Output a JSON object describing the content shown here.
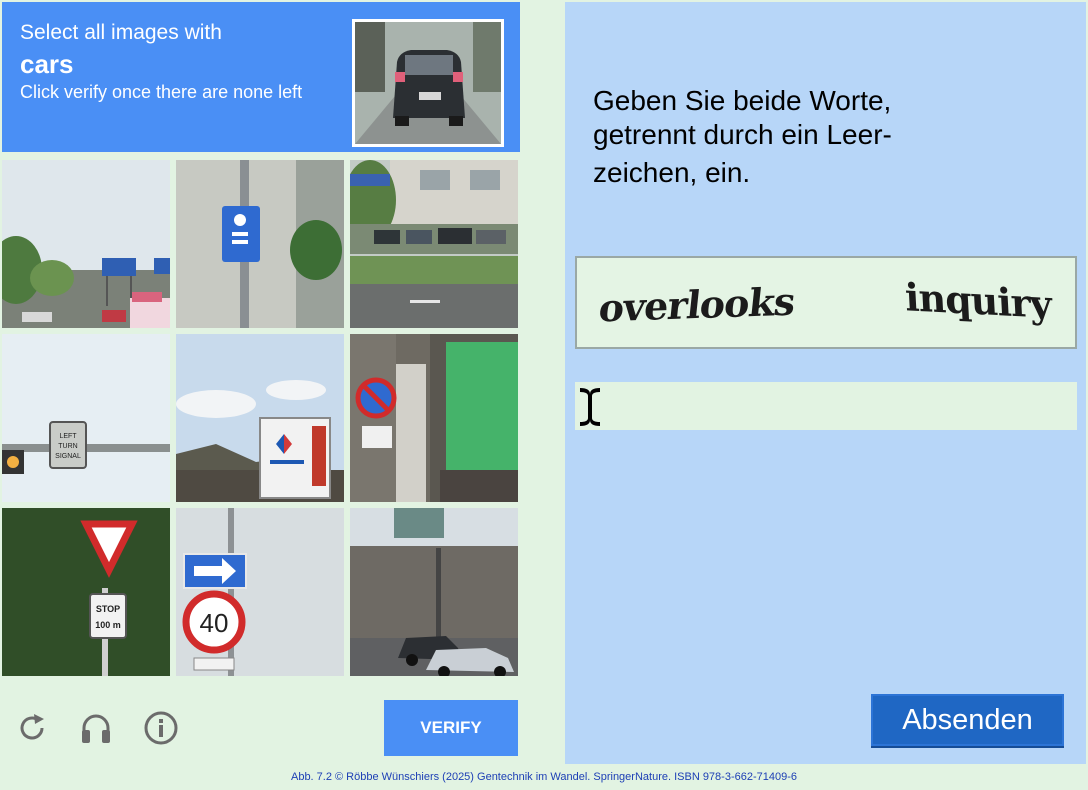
{
  "image_captcha": {
    "header": {
      "line1": "Select all images with",
      "target": "cars",
      "line3": "Click verify once there are none left"
    },
    "tiles": [
      {
        "name": "highway-road-signs"
      },
      {
        "name": "disabled-parking-sign"
      },
      {
        "name": "parked-cars-street"
      },
      {
        "name": "left-turn-signal-sign",
        "text": "LEFT TURN SIGNAL"
      },
      {
        "name": "carrefour-sign"
      },
      {
        "name": "no-stopping-sign"
      },
      {
        "name": "yield-stop-sign",
        "text": "STOP 100 m"
      },
      {
        "name": "speed-limit-40-sign",
        "text": "40"
      },
      {
        "name": "cars-on-road"
      }
    ],
    "footer": {
      "verify_label": "VERIFY",
      "icons": [
        "reload-icon",
        "headphones-icon",
        "info-icon"
      ]
    },
    "accent_color": "#4a8ff5"
  },
  "text_captcha": {
    "instruction_lines": [
      "Geben Sie beide Worte,",
      "getrennt durch ein Leer-",
      "zeichen, ein."
    ],
    "words": [
      "overlooks",
      "inquiry"
    ],
    "answer_value": "",
    "submit_label": "Absenden",
    "panel_color": "#b7d6f8",
    "button_color": "#1f67c4"
  },
  "credit": "Abb. 7.2 © Röbbe Wünschiers (2025) Gentechnik im Wandel. SpringerNature. ISBN 978-3-662-71409-6"
}
